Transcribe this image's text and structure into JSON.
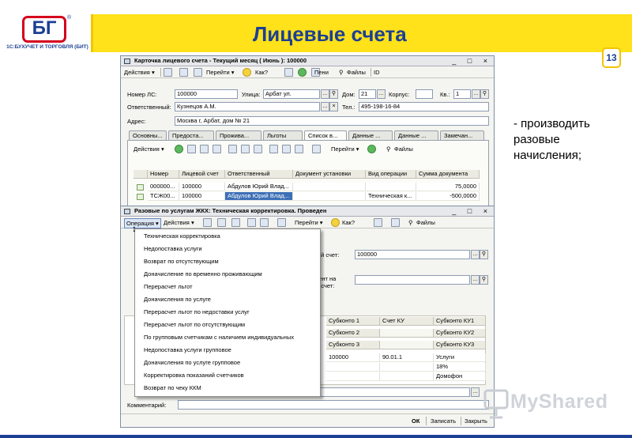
{
  "slide": {
    "title": "Лицевые счета",
    "page_number": "13",
    "bullet_text": "- производить разовые начисления;",
    "logo": {
      "mark": "БГ",
      "registered": "®",
      "caption": "1С:БУХУЧЕТ И ТОРГОВЛЯ (БИТ)"
    },
    "watermark": "MyShared"
  },
  "window1": {
    "title": "Карточка лицевого счета - Текущий месяц ( Июнь ): 100000",
    "controls": "_ □ ×",
    "toolbar": {
      "actions": "Действия ▾",
      "goto": "Перейти ▾",
      "how": "Как?",
      "penalties": "Пени",
      "files": "Файлы",
      "id": "ID"
    },
    "form": {
      "ls_label": "Номер ЛС:",
      "ls_value": "100000",
      "street_label": "Улица:",
      "street_value": "Арбат ул.",
      "house_label": "Дом:",
      "house_value": "21",
      "korpus_label": "Корпус:",
      "korpus_value": "",
      "kv_label": "Кв.:",
      "kv_value": "1",
      "resp_label": "Ответственный:",
      "resp_value": "Кузнецов А.М.",
      "tel_label": "Тел.:",
      "tel_value": "495-198-16-84",
      "addr_label": "Адрес:",
      "addr_value": "Москва г, Арбат, дом № 21"
    },
    "tabs": [
      "Основны...",
      "Предоста...",
      "Прожива...",
      "Льготы",
      "Список в...",
      "Данные ...",
      "Данные ...",
      "Замечан..."
    ],
    "inner_toolbar": {
      "actions": "Действия ▾",
      "goto": "Перейти ▾",
      "files": "Файлы"
    },
    "table": {
      "columns": [
        "Номер",
        "Лицевой счет",
        "Ответственный",
        "Документ установки",
        "Вид операции",
        "Сумма документа"
      ],
      "rows": [
        [
          "000000...",
          "100000",
          "Абдулов Юрий Влад...",
          "",
          "",
          "75,0000"
        ],
        [
          "ТСЖ00...",
          "100000",
          "Абдулов Юрий Влад...",
          "",
          "Техническая к...",
          "-500,0000"
        ]
      ]
    }
  },
  "window2": {
    "title": "Разовые по услугам ЖКХ: Техническая корректировка. Проведен",
    "controls": "_ □ ×",
    "toolbar": {
      "operation": "Операция ▾",
      "actions": "Действия ▾",
      "goto": "Перейти ▾",
      "how": "Как?",
      "files": "Файлы"
    },
    "form": {
      "account_label": "вой счет:",
      "account_value": "100000",
      "doc_label_1": "мент на",
      "doc_label_2": "расчет:",
      "doc_value": ""
    },
    "subkonto_table": {
      "columns": [
        "Субконто 1",
        "Счет КУ",
        "Субконто КУ1"
      ],
      "header_rows": [
        [
          "Субконто 2",
          "",
          "Субконто КУ2"
        ],
        [
          "Субконто 3",
          "",
          "Субконто КУ3"
        ]
      ],
      "rows": [
        [
          "100000",
          "90.01.1",
          "Услуги"
        ],
        [
          "",
          "",
          "18%"
        ],
        [
          "",
          "",
          "Домофон"
        ]
      ]
    },
    "comment_label": "Комментарий:",
    "comment_value": "",
    "footer": {
      "ok": "ОК",
      "save": "Записать",
      "close": "Закрыть"
    }
  },
  "operation_menu": {
    "items": [
      "Техническая корректировка",
      "Недопоставка услуги",
      "Возврат по отсутствующим",
      "Доначисление по временно проживающим",
      "Перерасчет льгот",
      "Доначисления по услуге",
      "Перерасчет льгот по недоставки услуг",
      "Перерасчет льгот по отсутствующим",
      "По групповым счетчикам с наличием индивидуальных",
      "Недопоставка услуги групповое",
      "Доначисления по услуге групповое",
      "Корректировка показаний счетчиков",
      "Возврат по чеку ККМ"
    ]
  }
}
